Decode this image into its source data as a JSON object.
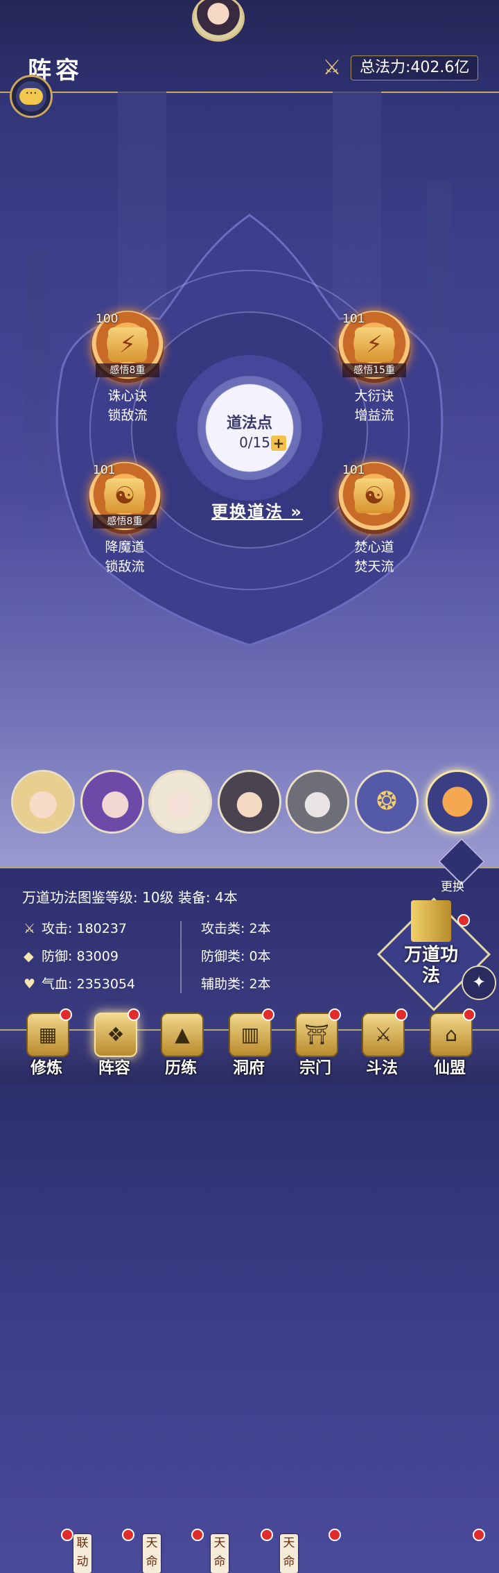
{
  "header": {
    "title": "阵容",
    "power_label": "总法力:402.6亿",
    "icons": {
      "chat": "chat-bubble-icon",
      "power": "crossed-swords-icon",
      "avatar": "player-avatar"
    }
  },
  "center": {
    "dao_label": "道法点",
    "dao_count": "0/15",
    "dao_plus": "+",
    "switch_label": "更换道法"
  },
  "skills": [
    {
      "level": "100",
      "insight": "感悟8重",
      "name": "诛心诀",
      "flow": "锁敌流"
    },
    {
      "level": "101",
      "insight": "感悟15重",
      "name": "大衍诀",
      "flow": "增益流"
    },
    {
      "level": "101",
      "insight": "感悟8重",
      "name": "降魔道",
      "flow": "锁敌流"
    },
    {
      "level": "101",
      "insight": "",
      "name": "焚心道",
      "flow": "焚天流"
    }
  ],
  "heroes": [
    {
      "tag": ""
    },
    {
      "tag": "联动"
    },
    {
      "tag": "天命"
    },
    {
      "tag": "天命"
    },
    {
      "tag": "天命"
    },
    {
      "tag": ""
    },
    {
      "tag": ""
    }
  ],
  "change_label": "更换",
  "info": {
    "head": "万道功法图鉴等级: 10级  装备: 4本",
    "attack": "攻击: 180237",
    "defense": "防御: 83009",
    "hp": "气血: 2353054",
    "attack_type": "攻击类: 2本",
    "defense_type": "防御类: 0本",
    "support_type": "辅助类: 2本",
    "wandao_label": "万道功法"
  },
  "nav": [
    {
      "label": "修炼",
      "icon": "cultivate-icon"
    },
    {
      "label": "阵容",
      "icon": "formation-icon"
    },
    {
      "label": "历练",
      "icon": "trial-icon"
    },
    {
      "label": "洞府",
      "icon": "cave-icon"
    },
    {
      "label": "宗门",
      "icon": "sect-icon"
    },
    {
      "label": "斗法",
      "icon": "duel-icon"
    },
    {
      "label": "仙盟",
      "icon": "alliance-icon"
    }
  ]
}
